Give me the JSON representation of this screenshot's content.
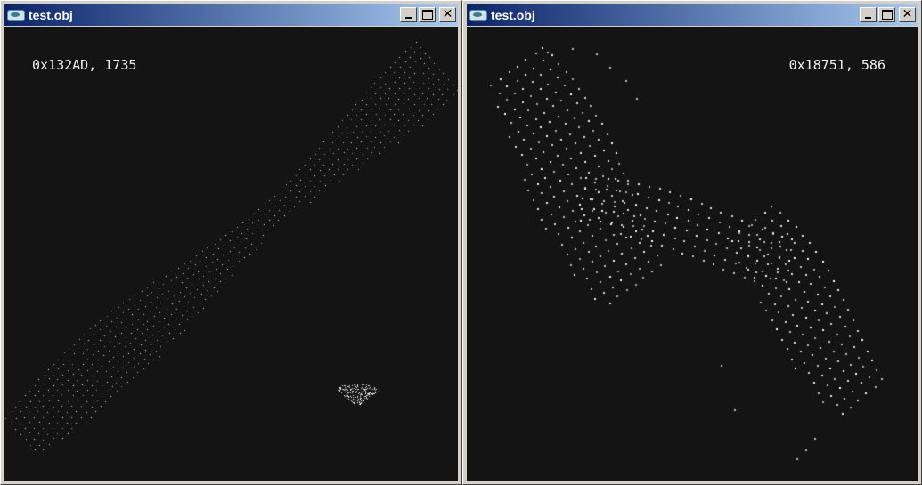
{
  "windows": [
    {
      "title": "test.obj",
      "readout": "0x132AD, 1735",
      "icon": "app-window-icon",
      "buttons": {
        "minimize": "_",
        "maximize": "□",
        "close": "✕"
      }
    },
    {
      "title": "test.obj",
      "readout": "0x18751, 586",
      "icon": "app-window-icon",
      "buttons": {
        "minimize": "_",
        "maximize": "□",
        "close": "✕"
      }
    }
  ],
  "colors": {
    "titlebar_start": "#0a246a",
    "titlebar_end": "#a6caf0",
    "viewport_bg": "#141414",
    "point": "#ffffff"
  }
}
